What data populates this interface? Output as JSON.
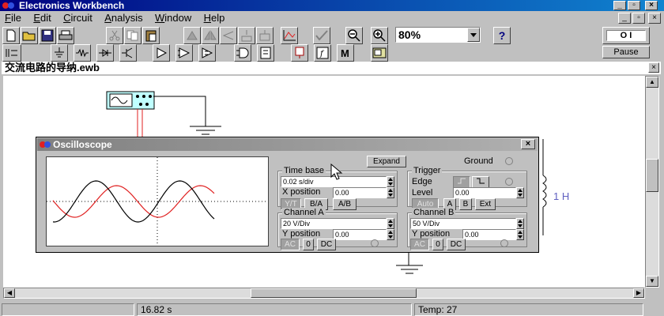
{
  "app": {
    "title": "Electronics Workbench"
  },
  "menu": [
    "File",
    "Edit",
    "Circuit",
    "Analysis",
    "Window",
    "Help"
  ],
  "menu_hotkeys": [
    "F",
    "E",
    "C",
    "A",
    "W",
    "H"
  ],
  "zoom": {
    "value": "80%"
  },
  "toolbar": {
    "help": "?",
    "pause_label": "Pause",
    "power_switch": "O  I"
  },
  "document": {
    "title": "交流电路的导纳.ewb"
  },
  "circuit": {
    "inductor_label": "1 H"
  },
  "oscilloscope": {
    "title": "Oscilloscope",
    "expand_label": "Expand",
    "ground_label": "Ground",
    "timebase": {
      "label": "Time base",
      "value": "0.02 s/div",
      "xpos_label": "X position",
      "xpos_value": "0.00",
      "modes": [
        "Y/T",
        "B/A",
        "A/B"
      ]
    },
    "trigger": {
      "label": "Trigger",
      "edge_label": "Edge",
      "level_label": "Level",
      "level_value": "0.00",
      "sources": [
        "Auto",
        "A",
        "B",
        "Ext"
      ]
    },
    "channel_a": {
      "label": "Channel A",
      "value": "20 V/Div",
      "ypos_label": "Y position",
      "ypos_value": "0.00",
      "coupling": [
        "AC",
        "0",
        "DC"
      ]
    },
    "channel_b": {
      "label": "Channel B",
      "value": "50 V/Div",
      "ypos_label": "Y position",
      "ypos_value": "0.00",
      "coupling": [
        "AC",
        "0",
        "DC"
      ]
    },
    "traces": {
      "a_color": "#000000",
      "b_color": "#e02020"
    }
  },
  "status": {
    "time": "16.82 s",
    "temp": "Temp:  27"
  }
}
